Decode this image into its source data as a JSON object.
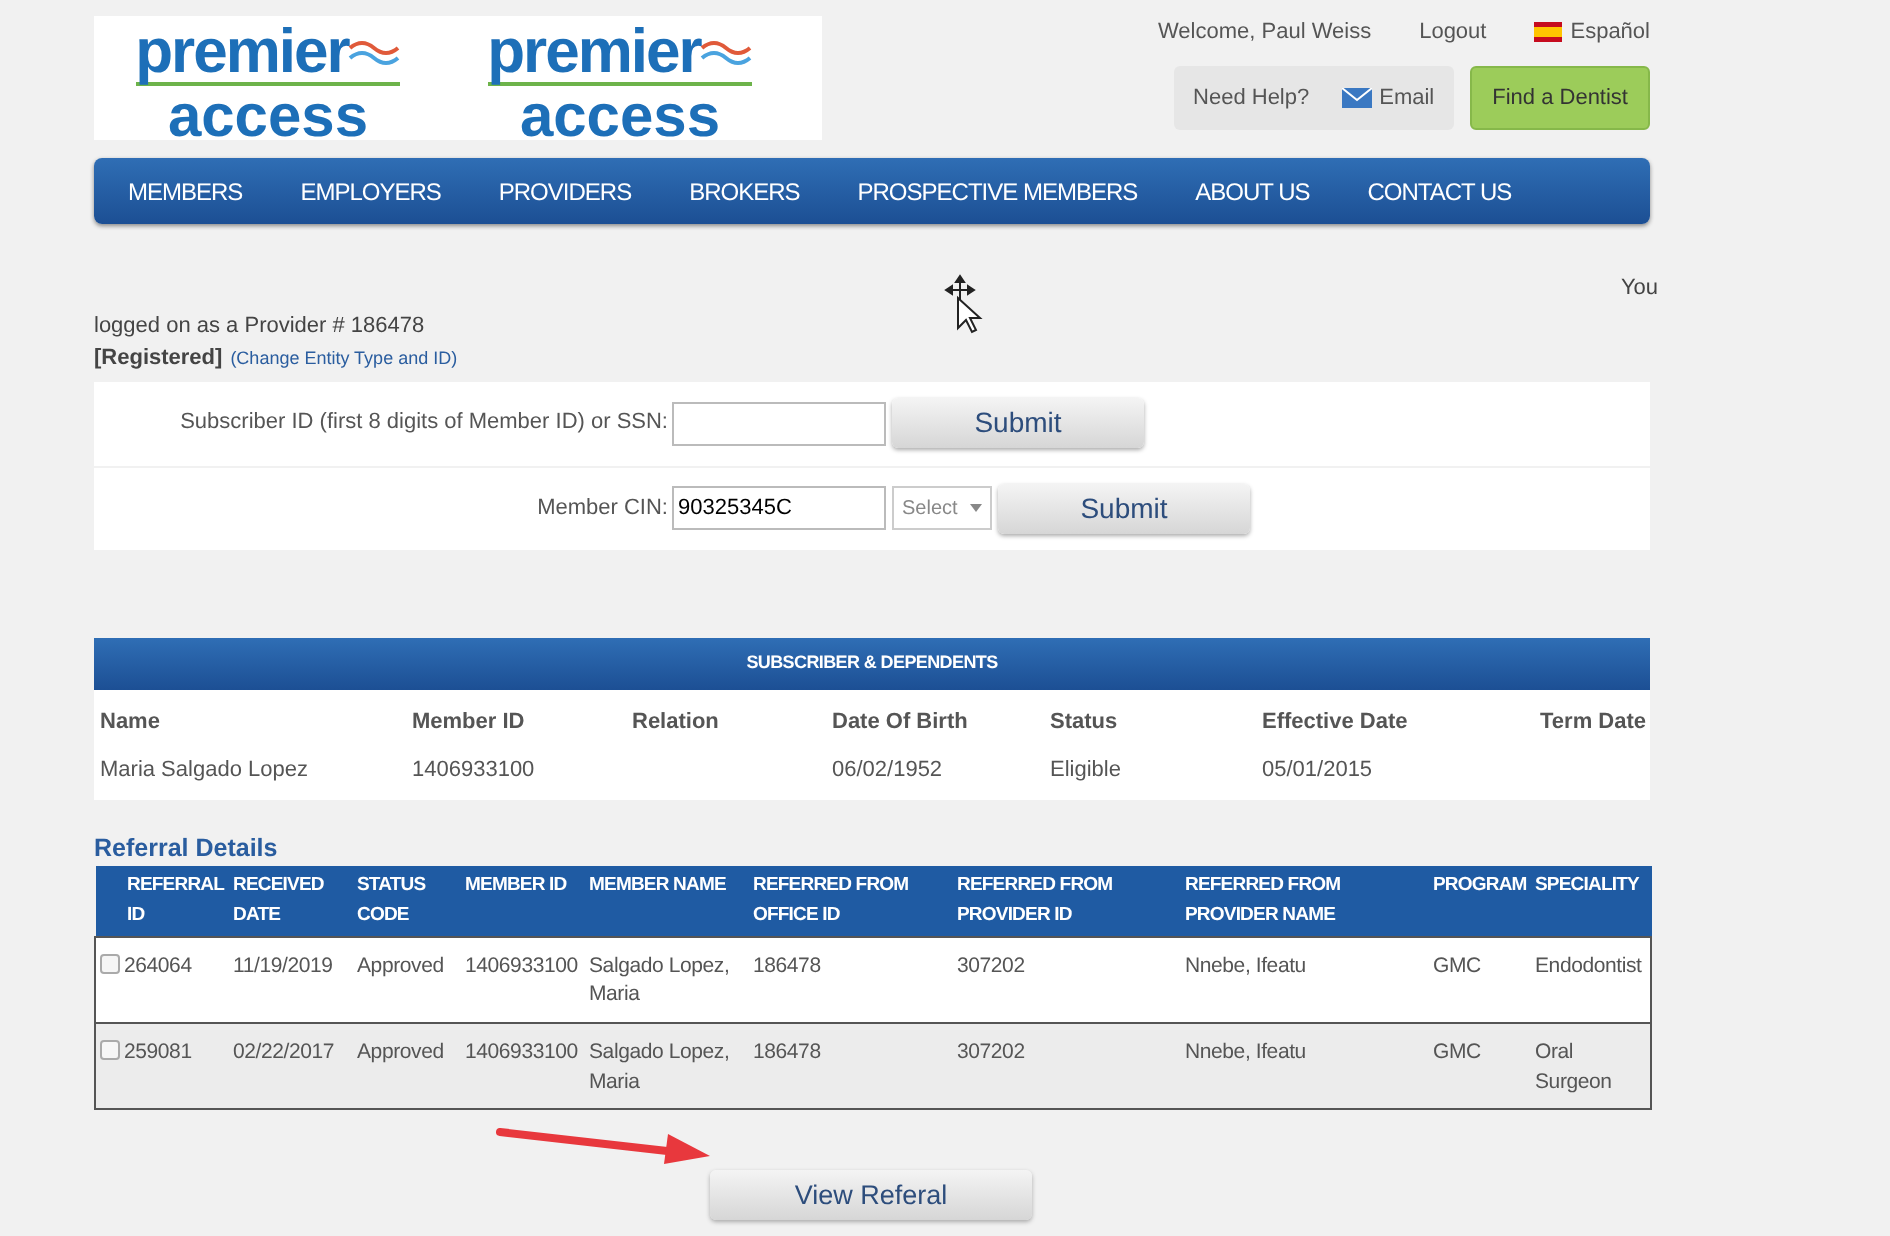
{
  "header": {
    "logos": [
      {
        "line1": "premier",
        "line2": "access"
      },
      {
        "line1": "premier",
        "line2": "access"
      }
    ],
    "welcome": "Welcome, Paul Weiss",
    "logout": "Logout",
    "language": "Español",
    "help": {
      "label": "Need Help?",
      "email": "Email"
    },
    "find_dentist": "Find a Dentist"
  },
  "nav": {
    "items": [
      "MEMBERS",
      "EMPLOYERS",
      "PROVIDERS",
      "BROKERS",
      "PROSPECTIVE MEMBERS",
      "ABOUT US",
      "CONTACT US"
    ]
  },
  "login_info": {
    "you": "You",
    "provider": "logged on as a Provider # 186478",
    "registered": "[Registered]",
    "change_link": "(Change Entity Type and ID)"
  },
  "search_form": {
    "rows": [
      {
        "kind": "plain",
        "label": "Subscriber ID (first 8 digits of Member ID) or SSN:",
        "value": "",
        "button": "Submit"
      },
      {
        "kind": "select",
        "label": "Member CIN:",
        "value": "90325345C",
        "select": "Select",
        "button": "Submit"
      }
    ]
  },
  "subscribers": {
    "title": "SUBSCRIBER & DEPENDENTS",
    "columns": [
      "Name",
      "Member ID",
      "Relation",
      "Date Of Birth",
      "Status",
      "Effective Date",
      "Term Date"
    ],
    "rows": [
      [
        "Maria Salgado Lopez",
        "1406933100",
        "",
        "06/02/1952",
        "Eligible",
        "05/01/2015",
        ""
      ]
    ]
  },
  "referrals": {
    "title": "Referral Details",
    "columns": [
      "REFERRAL ID",
      "RECEIVED DATE",
      "STATUS CODE",
      "MEMBER ID",
      "MEMBER NAME",
      "REFERRED FROM OFFICE ID",
      "REFERRED FROM PROVIDER ID",
      "REFERRED FROM PROVIDER NAME",
      "PROGRAM",
      "SPECIALITY"
    ],
    "rows": [
      {
        "checked": false,
        "cells": [
          "264064",
          "11/19/2019",
          "Approved",
          "1406933100",
          "Salgado Lopez, Maria",
          "186478",
          "307202",
          "Nnebe, Ifeatu",
          "GMC",
          "Endodontist"
        ]
      },
      {
        "checked": false,
        "cells": [
          "259081",
          "02/22/2017",
          "Approved",
          "1406933100",
          "Salgado Lopez, Maria",
          "186478",
          "307202",
          "Nnebe, Ifeatu",
          "GMC",
          "Oral Surgeon"
        ]
      }
    ]
  },
  "view_button": "View Referal"
}
